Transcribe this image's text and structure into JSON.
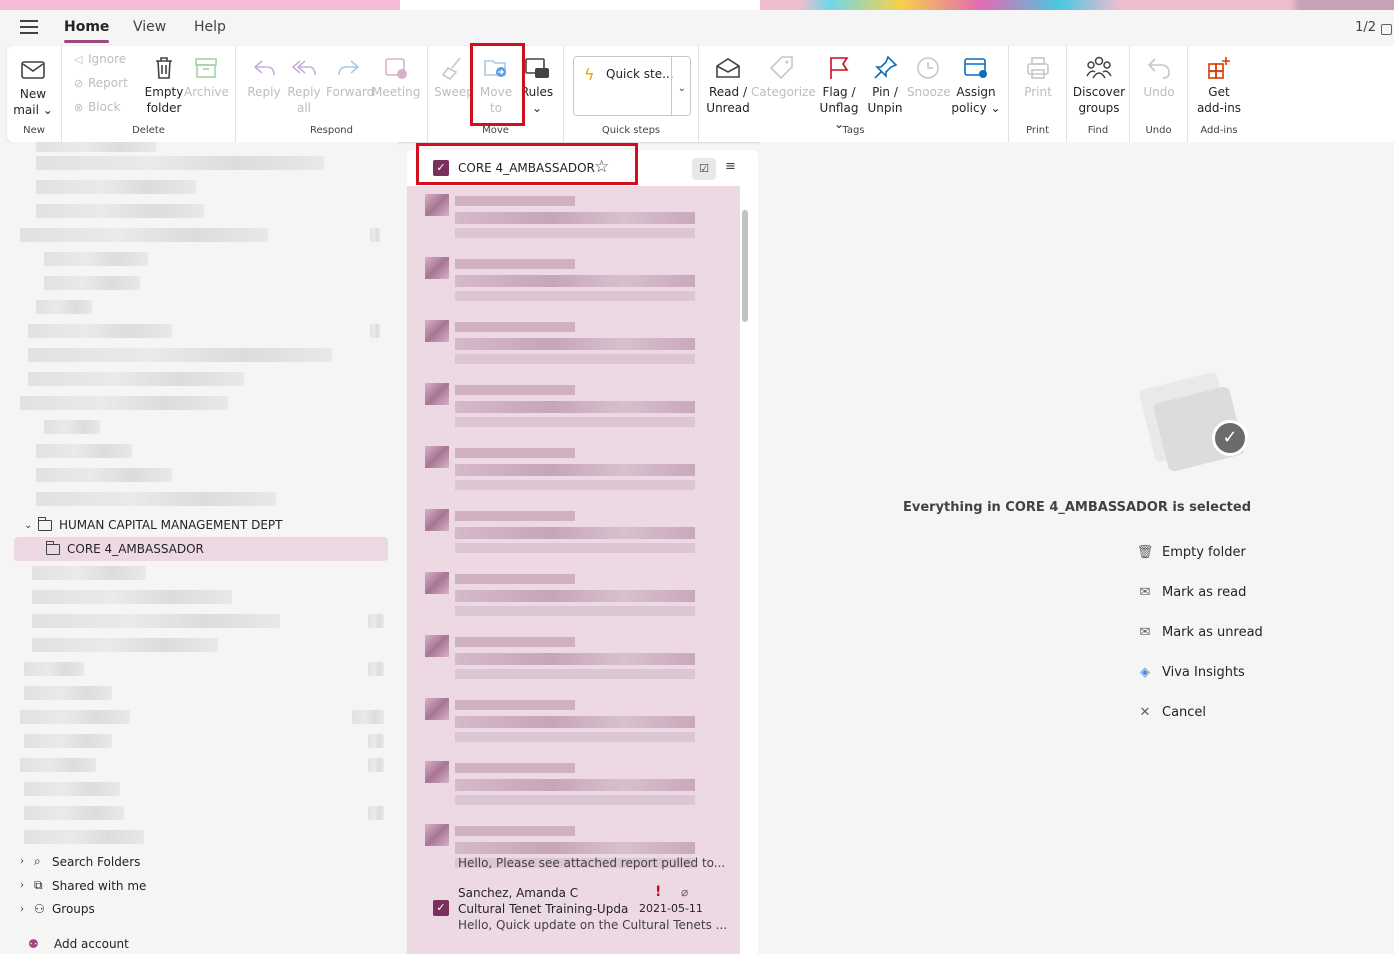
{
  "menu": {
    "tabs": [
      {
        "label": "Home",
        "active": true
      },
      {
        "label": "View",
        "active": false
      },
      {
        "label": "Help",
        "active": false
      }
    ],
    "pager": "1/2"
  },
  "ribbon": {
    "groups": {
      "new": "New",
      "delete": "Delete",
      "respond": "Respond",
      "move": "Move",
      "quick_steps": "Quick steps",
      "tags": "Tags",
      "print": "Print",
      "find": "Find",
      "undo": "Undo",
      "addins": "Add-ins"
    },
    "buttons": {
      "new_mail_1": "New",
      "new_mail_2": "mail",
      "ignore": "Ignore",
      "report": "Report",
      "block": "Block",
      "empty_folder_1": "Empty",
      "empty_folder_2": "folder",
      "archive": "Archive",
      "reply": "Reply",
      "reply_all_1": "Reply",
      "reply_all_2": "all",
      "forward": "Forward",
      "meeting": "Meeting",
      "sweep": "Sweep",
      "move_to_1": "Move",
      "move_to_2": "to",
      "rules": "Rules",
      "quick_steps_box": "Quick ste...",
      "read_unread_1": "Read /",
      "read_unread_2": "Unread",
      "categorize": "Categorize",
      "flag_1": "Flag /",
      "flag_2": "Unflag",
      "pin_1": "Pin /",
      "pin_2": "Unpin",
      "snooze": "Snooze",
      "assign_1": "Assign",
      "assign_2": "policy",
      "print": "Print",
      "discover_1": "Discover",
      "discover_2": "groups",
      "undo": "Undo",
      "get_addins_1": "Get",
      "get_addins_2": "add-ins"
    }
  },
  "sidebar": {
    "parent_folder": "HUMAN CAPITAL MANAGEMENT DEPT",
    "selected_folder": "CORE 4_AMBASSADOR",
    "bottom": {
      "search_folders": "Search Folders",
      "shared_with_me": "Shared with me",
      "groups": "Groups",
      "add_account": "Add account"
    }
  },
  "list": {
    "title": "CORE 4_AMBASSADOR",
    "preview_partial": "Hello, Please see attached report pulled to...",
    "visible_mail": {
      "sender": "Sanchez, Amanda C",
      "subject": "Cultural Tenet Training-Updat...",
      "date": "2021-05-11",
      "preview": "Hello, Quick update on the Cultural Tenets ..."
    }
  },
  "reading": {
    "selected_text": "Everything in CORE 4_AMBASSADOR is selected",
    "actions": [
      {
        "label": "Empty folder",
        "icon": "trash-icon"
      },
      {
        "label": "Mark as read",
        "icon": "open-envelope-icon"
      },
      {
        "label": "Mark as unread",
        "icon": "envelope-icon"
      },
      {
        "label": "Viva Insights",
        "icon": "viva-insights-icon"
      },
      {
        "label": "Cancel",
        "icon": "close-icon"
      }
    ]
  },
  "colors": {
    "accent": "#9e4a7e",
    "selection": "#ecd9e4",
    "checkbox": "#7a2f5c",
    "highlight": "#d20f1e"
  }
}
